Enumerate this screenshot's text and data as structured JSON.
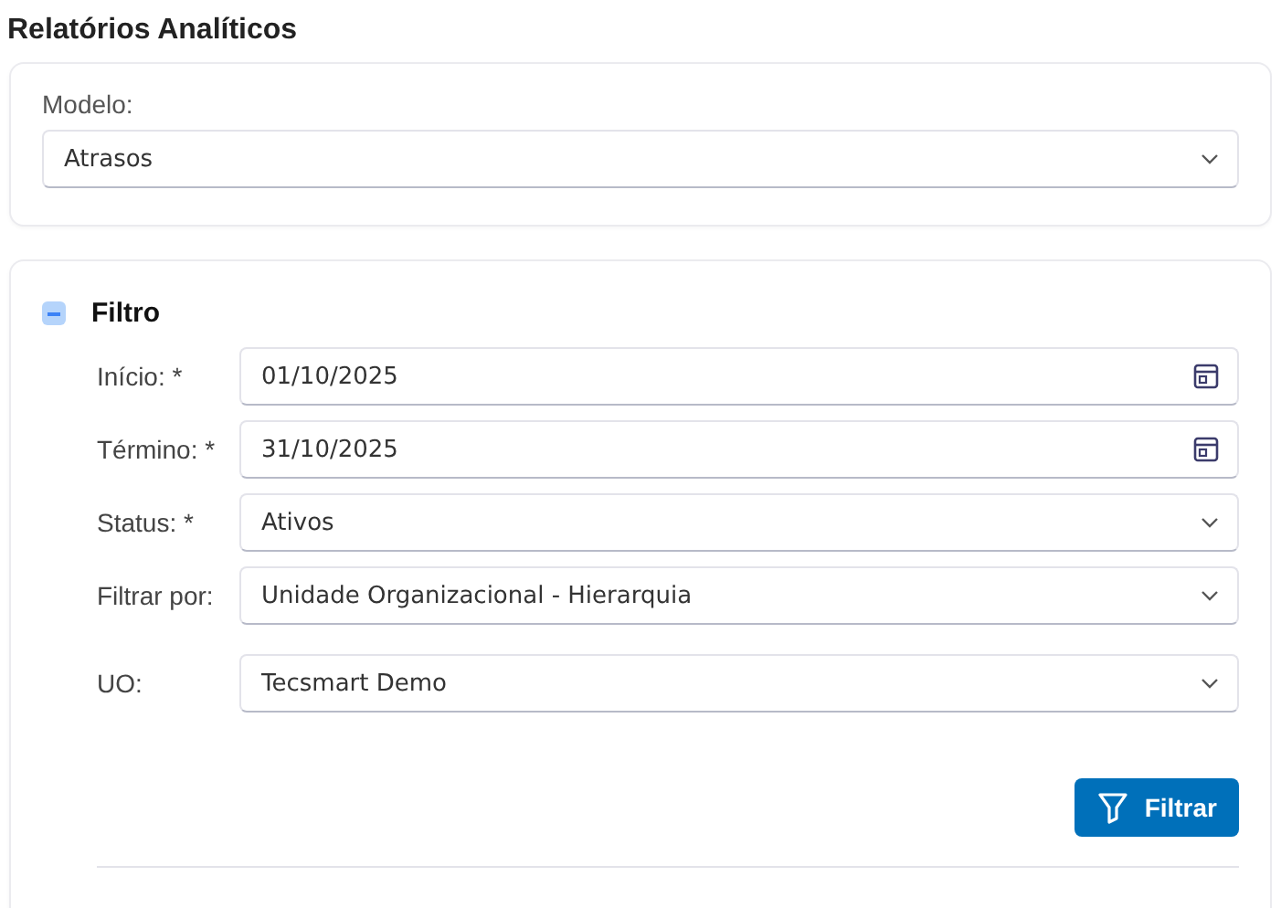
{
  "page_title": "Relatórios Analíticos",
  "model": {
    "label": "Modelo:",
    "value": "Atrasos"
  },
  "filter": {
    "title": "Filtro",
    "expanded": true,
    "fields": [
      {
        "label": "Início: *",
        "value": "01/10/2025",
        "kind": "date"
      },
      {
        "label": "Término: *",
        "value": "31/10/2025",
        "kind": "date"
      },
      {
        "label": "Status: *",
        "value": "Ativos",
        "kind": "select"
      },
      {
        "label": "Filtrar por:",
        "value": "Unidade Organizacional - Hierarquia",
        "kind": "select"
      },
      {
        "label": "UO:",
        "value": "Tecsmart Demo",
        "kind": "select",
        "spaced": true
      }
    ],
    "button": "Filtrar"
  }
}
